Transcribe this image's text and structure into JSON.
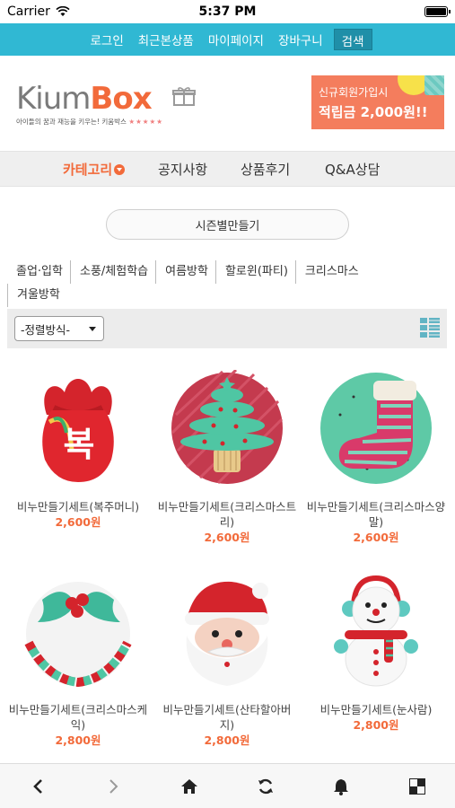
{
  "status_bar": {
    "carrier": "Carrier",
    "time": "5:37 PM"
  },
  "top_nav": {
    "items": [
      "로그인",
      "최근본상품",
      "마이페이지",
      "장바구니"
    ],
    "search_label": "검색"
  },
  "header": {
    "logo_kium": "Kium",
    "logo_box": "Box",
    "tagline": "아이들의 꿈과 재능을 키우는! 키움박스",
    "tagline_stars": "★★★★★",
    "promo_line1": "신규회원가입시",
    "promo_line2": "적립금 2,000원!!"
  },
  "category_nav": {
    "items": [
      "카테고리",
      "공지사항",
      "상품후기",
      "Q&A상담"
    ]
  },
  "season_button": "시즌별만들기",
  "subcategories": [
    "졸업·입학",
    "소풍/체험학습",
    "여름방학",
    "할로윈(파티)",
    "크리스마스",
    "겨울방학"
  ],
  "sort": {
    "selected": "-정렬방식-"
  },
  "products": [
    {
      "name": "비누만들기세트(복주머니)",
      "price": "2,600원",
      "icon": "lucky-bag-soap"
    },
    {
      "name": "비누만들기세트(크리스마스트리)",
      "price": "2,600원",
      "icon": "christmas-tree-soap"
    },
    {
      "name": "비누만들기세트(크리스마스양말)",
      "price": "2,600원",
      "icon": "christmas-stocking-soap"
    },
    {
      "name": "비누만들기세트(크리스마스케익)",
      "price": "2,800원",
      "icon": "christmas-cake-soap"
    },
    {
      "name": "비누만들기세트(산타할아버지)",
      "price": "2,800원",
      "icon": "santa-soap"
    },
    {
      "name": "비누만들기세트(눈사람)",
      "price": "2,800원",
      "icon": "snowman-soap"
    }
  ],
  "bottom_bar": [
    "back-icon",
    "forward-icon",
    "home-icon",
    "refresh-icon",
    "bell-icon",
    "grid-icon"
  ],
  "colors": {
    "accent": "#30b8d3",
    "brand": "#f26a3a",
    "price": "#f26a3a",
    "promo": "#f47d5d"
  }
}
